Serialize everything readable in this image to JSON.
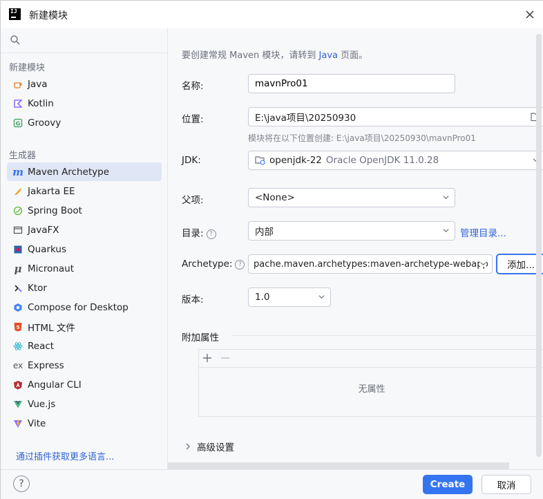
{
  "window": {
    "title": "新建模块"
  },
  "sidebar": {
    "search_placeholder": "",
    "group_new": "新建模块",
    "new_items": [
      {
        "label": "Java",
        "icon": "java-cup-icon"
      },
      {
        "label": "Kotlin",
        "icon": "kotlin-icon"
      },
      {
        "label": "Groovy",
        "icon": "groovy-icon"
      }
    ],
    "group_generators": "生成器",
    "generator_items": [
      {
        "label": "Maven Archetype",
        "icon": "maven-icon",
        "selected": true
      },
      {
        "label": "Jakarta EE",
        "icon": "jakarta-icon"
      },
      {
        "label": "Spring Boot",
        "icon": "spring-icon"
      },
      {
        "label": "JavaFX",
        "icon": "javafx-icon"
      },
      {
        "label": "Quarkus",
        "icon": "quarkus-icon"
      },
      {
        "label": "Micronaut",
        "icon": "micronaut-icon"
      },
      {
        "label": "Ktor",
        "icon": "ktor-icon"
      },
      {
        "label": "Compose for Desktop",
        "icon": "compose-icon"
      },
      {
        "label": "HTML 文件",
        "icon": "html-icon"
      },
      {
        "label": "React",
        "icon": "react-icon"
      },
      {
        "label": "Express",
        "icon": "express-icon"
      },
      {
        "label": "Angular CLI",
        "icon": "angular-icon"
      },
      {
        "label": "Vue.js",
        "icon": "vue-icon"
      },
      {
        "label": "Vite",
        "icon": "vite-icon"
      }
    ],
    "plugin_link": "通过插件获取更多语言..."
  },
  "main": {
    "hint_prefix": "要创建常规 Maven 模块，请转到 ",
    "hint_link": "Java",
    "hint_suffix": " 页面。",
    "name_label": "名称:",
    "name_value": "mavnPro01",
    "location_label": "位置:",
    "location_value": "E:\\java项目\\20250930",
    "location_hint": "模块将在以下位置创建: E:\\java项目\\20250930\\mavnPro01",
    "jdk_label": "JDK:",
    "jdk_name": "openjdk-22",
    "jdk_desc": "Oracle OpenJDK 11.0.28",
    "parent_label": "父项:",
    "parent_value": "<None>",
    "catalog_label": "目录:",
    "catalog_value": "内部",
    "catalog_manage": "管理目录...",
    "archetype_label": "Archetype:",
    "archetype_value": "pache.maven.archetypes:maven-archetype-webapp",
    "archetype_add": "添加...",
    "version_label": "版本:",
    "version_value": "1.0",
    "props_title": "附加属性",
    "props_empty": "无属性",
    "advanced_label": "高级设置"
  },
  "footer": {
    "help": "?",
    "create": "Create",
    "cancel": "取消"
  },
  "colors": {
    "accent": "#3574f0",
    "link": "#2f63d6",
    "selected_bg": "#dfe6f5"
  }
}
